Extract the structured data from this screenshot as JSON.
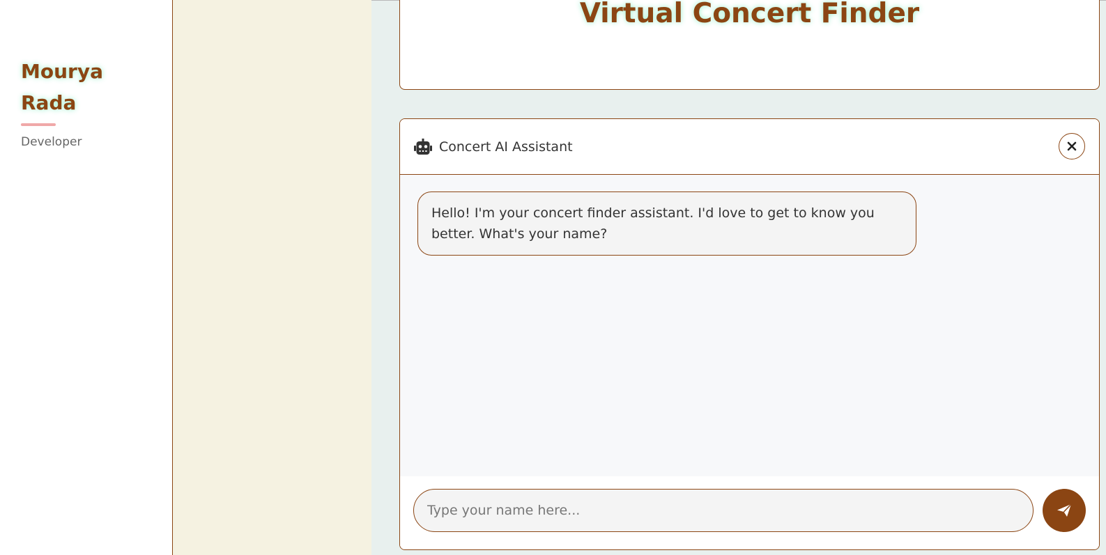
{
  "sidebar": {
    "author_name": "Mourya Rada",
    "author_role": "Developer"
  },
  "header": {
    "title": "Virtual Concert Finder"
  },
  "chat": {
    "title": "Concert AI Assistant",
    "messages": [
      {
        "sender": "bot",
        "text": "Hello! I'm your concert finder assistant. I'd love to get to know you better. What's your name?"
      }
    ],
    "input_placeholder": "Type your name here...",
    "input_value": ""
  },
  "icons": {
    "assistant": "robot-icon",
    "close": "close-icon",
    "send": "paper-plane-icon"
  },
  "colors": {
    "accent": "#8b4513",
    "title_glow": "#90eec8",
    "underline": "#f0a8a8",
    "cream_panel": "#f5f2e1",
    "page_background": "#e8f0ee",
    "message_background": "#f4f4f4"
  }
}
